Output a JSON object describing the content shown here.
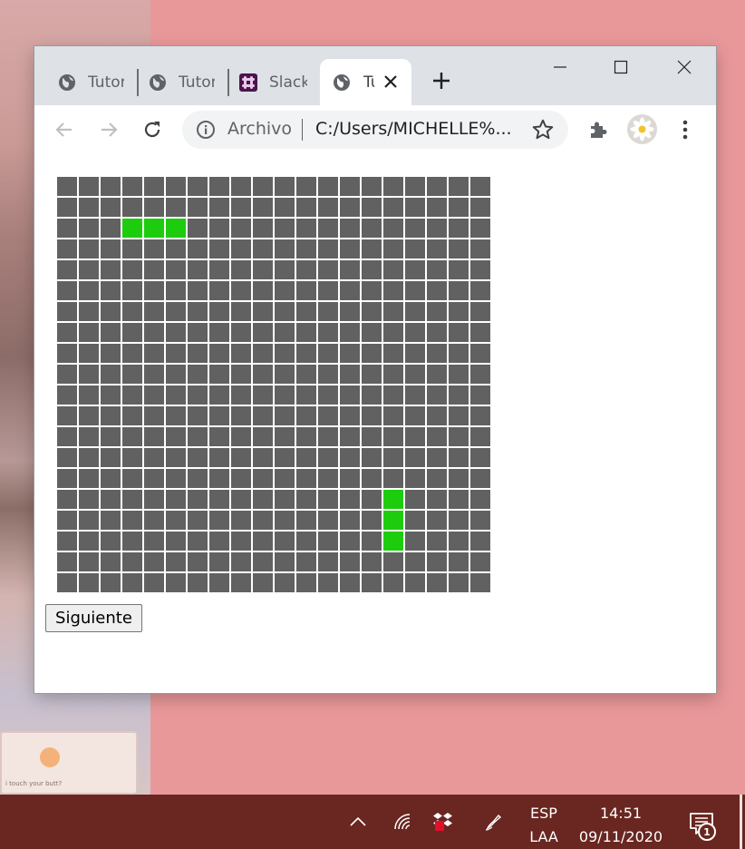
{
  "browser": {
    "tabs": [
      {
        "title": "Tutor",
        "icon": "globe-icon",
        "active": false
      },
      {
        "title": "Tutor",
        "icon": "globe-icon",
        "active": false
      },
      {
        "title": "Slack",
        "icon": "slack-icon",
        "active": false
      },
      {
        "title": "Tu",
        "icon": "globe-icon",
        "active": true
      }
    ],
    "address": {
      "chip": "Archivo",
      "url": "C:/Users/MICHELLE%..."
    }
  },
  "board": {
    "rows": 20,
    "cols": 20,
    "live_cells": [
      [
        2,
        3
      ],
      [
        2,
        4
      ],
      [
        2,
        5
      ],
      [
        15,
        15
      ],
      [
        16,
        15
      ],
      [
        17,
        15
      ]
    ],
    "colors": {
      "dead": "#616161",
      "live": "#1ecc0e"
    }
  },
  "page": {
    "next_button_label": "Siguiente"
  },
  "taskbar": {
    "lang_line1": "ESP",
    "lang_line2": "LAA",
    "time": "14:51",
    "date": "09/11/2020",
    "notification_count": "1",
    "color": "#6a2620"
  },
  "wallpaper": {
    "card_caption": "i touch your butt?"
  }
}
